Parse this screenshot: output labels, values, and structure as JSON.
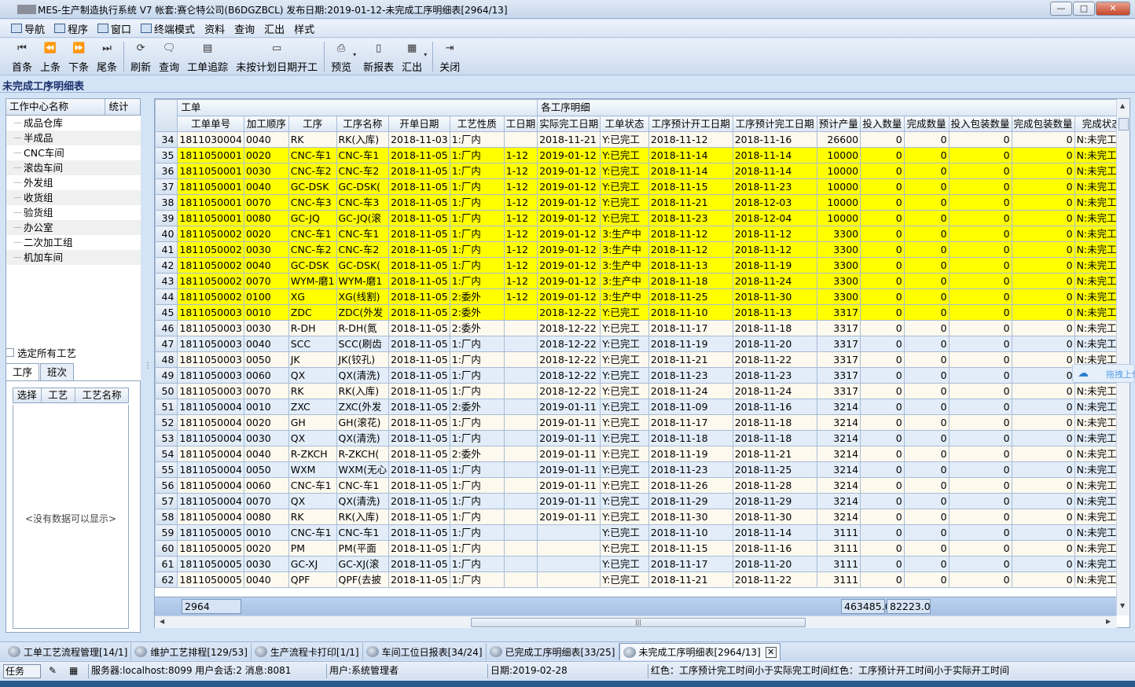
{
  "window": {
    "title": "MES-生产制造执行系统 V7 帐套:赛仑特公司(B6DGZBCL) 发布日期:2019-01-12-未完成工序明细表[2964/13]",
    "btn_min": "—",
    "btn_max": "□",
    "btn_close": "✕"
  },
  "menu": [
    {
      "label": "导航",
      "icon": "navigation-icon"
    },
    {
      "label": "程序",
      "icon": "program-icon"
    },
    {
      "label": "窗口",
      "icon": "window-icon"
    },
    {
      "label": "终端模式",
      "icon": "terminal-icon"
    },
    {
      "label": "资料"
    },
    {
      "label": "查询"
    },
    {
      "label": "汇出"
    },
    {
      "label": "样式"
    }
  ],
  "toolbar": {
    "first": "首条",
    "first_icon": "⏮",
    "prev": "上条",
    "prev_icon": "⏪",
    "next": "下条",
    "next_icon": "⏩",
    "last": "尾条",
    "last_icon": "⏭",
    "refresh": "刷新",
    "refresh_icon": "⟳",
    "query": "查询",
    "query_icon": "🗨",
    "trace": "工单追踪",
    "trace_icon": "▤",
    "unplanned": "未按计划日期开工",
    "unplanned_icon": "▭",
    "preview": "预览",
    "preview_icon": "⎙",
    "newreport": "新报表",
    "newreport_icon": "▯",
    "export": "汇出",
    "export_icon": "▦",
    "close": "关闭",
    "close_icon": "⇥",
    "dropdown": "▾"
  },
  "page_title": "未完成工序明细表",
  "left": {
    "col_name": "工作中心名称",
    "col_stat": "统计",
    "work_centers": [
      "成品仓库",
      "半成品",
      "CNC车间",
      "滚齿车间",
      "外发组",
      "收货组",
      "验货组",
      "办公室",
      "二次加工组",
      "机加车间"
    ],
    "select_all": "选定所有工艺",
    "tab_proc": "工序",
    "tab_shift": "班次",
    "proc_cols": [
      "选择",
      "工艺",
      "工艺名称"
    ],
    "empty": "<没有数据可以显示>"
  },
  "grid": {
    "band_wo": "工单",
    "band_detail": "各工序明细",
    "columns": [
      "工单单号",
      "加工顺序",
      "工序",
      "工序名称",
      "开单日期",
      "工艺性质",
      "工日期",
      "实际完工日期",
      "工单状态",
      "工序预计开工日期",
      "工序预计完工日期",
      "预计产量",
      "投入数量",
      "完成数量",
      "投入包装数量",
      "完成包装数量",
      "完成状态"
    ],
    "rows": [
      [
        "34",
        "1811030004",
        "0040",
        "RK",
        "RK(入库)",
        "2018-11-03",
        "1:厂内",
        "",
        "2018-11-21",
        "Y:已完工",
        "2018-11-12",
        "2018-11-16",
        "26600",
        "0",
        "0",
        "0",
        "0",
        "N:未完工"
      ],
      [
        "35",
        "1811050001",
        "0020",
        "CNC-车1",
        "CNC-车1",
        "2018-11-05",
        "1:厂内",
        "1-12",
        "2019-01-12",
        "Y:已完工",
        "2018-11-14",
        "2018-11-14",
        "10000",
        "0",
        "0",
        "0",
        "0",
        "N:未完工"
      ],
      [
        "36",
        "1811050001",
        "0030",
        "CNC-车2",
        "CNC-车2",
        "2018-11-05",
        "1:厂内",
        "1-12",
        "2019-01-12",
        "Y:已完工",
        "2018-11-14",
        "2018-11-14",
        "10000",
        "0",
        "0",
        "0",
        "0",
        "N:未完工"
      ],
      [
        "37",
        "1811050001",
        "0040",
        "GC-DSK",
        "GC-DSK(",
        "2018-11-05",
        "1:厂内",
        "1-12",
        "2019-01-12",
        "Y:已完工",
        "2018-11-15",
        "2018-11-23",
        "10000",
        "0",
        "0",
        "0",
        "0",
        "N:未完工"
      ],
      [
        "38",
        "1811050001",
        "0070",
        "CNC-车3",
        "CNC-车3",
        "2018-11-05",
        "1:厂内",
        "1-12",
        "2019-01-12",
        "Y:已完工",
        "2018-11-21",
        "2018-12-03",
        "10000",
        "0",
        "0",
        "0",
        "0",
        "N:未完工"
      ],
      [
        "39",
        "1811050001",
        "0080",
        "GC-JQ",
        "GC-JQ(滚",
        "2018-11-05",
        "1:厂内",
        "1-12",
        "2019-01-12",
        "Y:已完工",
        "2018-11-23",
        "2018-12-04",
        "10000",
        "0",
        "0",
        "0",
        "0",
        "N:未完工"
      ],
      [
        "40",
        "1811050002",
        "0020",
        "CNC-车1",
        "CNC-车1",
        "2018-11-05",
        "1:厂内",
        "1-12",
        "2019-01-12",
        "3:生产中",
        "2018-11-12",
        "2018-11-12",
        "3300",
        "0",
        "0",
        "0",
        "0",
        "N:未完工"
      ],
      [
        "41",
        "1811050002",
        "0030",
        "CNC-车2",
        "CNC-车2",
        "2018-11-05",
        "1:厂内",
        "1-12",
        "2019-01-12",
        "3:生产中",
        "2018-11-12",
        "2018-11-12",
        "3300",
        "0",
        "0",
        "0",
        "0",
        "N:未完工"
      ],
      [
        "42",
        "1811050002",
        "0040",
        "GC-DSK",
        "GC-DSK(",
        "2018-11-05",
        "1:厂内",
        "1-12",
        "2019-01-12",
        "3:生产中",
        "2018-11-13",
        "2018-11-19",
        "3300",
        "0",
        "0",
        "0",
        "0",
        "N:未完工"
      ],
      [
        "43",
        "1811050002",
        "0070",
        "WYM-磨1",
        "WYM-磨1",
        "2018-11-05",
        "1:厂内",
        "1-12",
        "2019-01-12",
        "3:生产中",
        "2018-11-18",
        "2018-11-24",
        "3300",
        "0",
        "0",
        "0",
        "0",
        "N:未完工"
      ],
      [
        "44",
        "1811050002",
        "0100",
        "XG",
        "XG(线割)",
        "2018-11-05",
        "2:委外",
        "1-12",
        "2019-01-12",
        "3:生产中",
        "2018-11-25",
        "2018-11-30",
        "3300",
        "0",
        "0",
        "0",
        "0",
        "N:未完工"
      ],
      [
        "45",
        "1811050003",
        "0010",
        "ZDC",
        "ZDC(外发",
        "2018-11-05",
        "2:委外",
        "",
        "2018-12-22",
        "Y:已完工",
        "2018-11-10",
        "2018-11-13",
        "3317",
        "0",
        "0",
        "0",
        "0",
        "N:未完工"
      ],
      [
        "46",
        "1811050003",
        "0030",
        "R-DH",
        "R-DH(氮",
        "2018-11-05",
        "2:委外",
        "",
        "2018-12-22",
        "Y:已完工",
        "2018-11-17",
        "2018-11-18",
        "3317",
        "0",
        "0",
        "0",
        "0",
        "N:未完工"
      ],
      [
        "47",
        "1811050003",
        "0040",
        "SCC",
        "SCC(刷齿",
        "2018-11-05",
        "1:厂内",
        "",
        "2018-12-22",
        "Y:已完工",
        "2018-11-19",
        "2018-11-20",
        "3317",
        "0",
        "0",
        "0",
        "0",
        "N:未完工"
      ],
      [
        "48",
        "1811050003",
        "0050",
        "JK",
        "JK(铰孔)",
        "2018-11-05",
        "1:厂内",
        "",
        "2018-12-22",
        "Y:已完工",
        "2018-11-21",
        "2018-11-22",
        "3317",
        "0",
        "0",
        "0",
        "0",
        "N:未完工"
      ],
      [
        "49",
        "1811050003",
        "0060",
        "QX",
        "QX(清洗)",
        "2018-11-05",
        "1:厂内",
        "",
        "2018-12-22",
        "Y:已完工",
        "2018-11-23",
        "2018-11-23",
        "3317",
        "0",
        "0",
        "0",
        "0",
        "N:未完工"
      ],
      [
        "50",
        "1811050003",
        "0070",
        "RK",
        "RK(入库)",
        "2018-11-05",
        "1:厂内",
        "",
        "2018-12-22",
        "Y:已完工",
        "2018-11-24",
        "2018-11-24",
        "3317",
        "0",
        "0",
        "0",
        "0",
        "N:未完工"
      ],
      [
        "51",
        "1811050004",
        "0010",
        "ZXC",
        "ZXC(外发",
        "2018-11-05",
        "2:委外",
        "",
        "2019-01-11",
        "Y:已完工",
        "2018-11-09",
        "2018-11-16",
        "3214",
        "0",
        "0",
        "0",
        "0",
        "N:未完工"
      ],
      [
        "52",
        "1811050004",
        "0020",
        "GH",
        "GH(滚花)",
        "2018-11-05",
        "1:厂内",
        "",
        "2019-01-11",
        "Y:已完工",
        "2018-11-17",
        "2018-11-18",
        "3214",
        "0",
        "0",
        "0",
        "0",
        "N:未完工"
      ],
      [
        "53",
        "1811050004",
        "0030",
        "QX",
        "QX(清洗)",
        "2018-11-05",
        "1:厂内",
        "",
        "2019-01-11",
        "Y:已完工",
        "2018-11-18",
        "2018-11-18",
        "3214",
        "0",
        "0",
        "0",
        "0",
        "N:未完工"
      ],
      [
        "54",
        "1811050004",
        "0040",
        "R-ZKCH",
        "R-ZKCH(",
        "2018-11-05",
        "2:委外",
        "",
        "2019-01-11",
        "Y:已完工",
        "2018-11-19",
        "2018-11-21",
        "3214",
        "0",
        "0",
        "0",
        "0",
        "N:未完工"
      ],
      [
        "55",
        "1811050004",
        "0050",
        "WXM",
        "WXM(无心",
        "2018-11-05",
        "1:厂内",
        "",
        "2019-01-11",
        "Y:已完工",
        "2018-11-23",
        "2018-11-25",
        "3214",
        "0",
        "0",
        "0",
        "0",
        "N:未完工"
      ],
      [
        "56",
        "1811050004",
        "0060",
        "CNC-车1",
        "CNC-车1",
        "2018-11-05",
        "1:厂内",
        "",
        "2019-01-11",
        "Y:已完工",
        "2018-11-26",
        "2018-11-28",
        "3214",
        "0",
        "0",
        "0",
        "0",
        "N:未完工"
      ],
      [
        "57",
        "1811050004",
        "0070",
        "QX",
        "QX(清洗)",
        "2018-11-05",
        "1:厂内",
        "",
        "2019-01-11",
        "Y:已完工",
        "2018-11-29",
        "2018-11-29",
        "3214",
        "0",
        "0",
        "0",
        "0",
        "N:未完工"
      ],
      [
        "58",
        "1811050004",
        "0080",
        "RK",
        "RK(入库)",
        "2018-11-05",
        "1:厂内",
        "",
        "2019-01-11",
        "Y:已完工",
        "2018-11-30",
        "2018-11-30",
        "3214",
        "0",
        "0",
        "0",
        "0",
        "N:未完工"
      ],
      [
        "59",
        "1811050005",
        "0010",
        "CNC-车1",
        "CNC-车1",
        "2018-11-05",
        "1:厂内",
        "",
        "",
        "Y:已完工",
        "2018-11-10",
        "2018-11-14",
        "3111",
        "0",
        "0",
        "0",
        "0",
        "N:未完工"
      ],
      [
        "60",
        "1811050005",
        "0020",
        "PM",
        "PM(平面",
        "2018-11-05",
        "1:厂内",
        "",
        "",
        "Y:已完工",
        "2018-11-15",
        "2018-11-16",
        "3111",
        "0",
        "0",
        "0",
        "0",
        "N:未完工"
      ],
      [
        "61",
        "1811050005",
        "0030",
        "GC-XJ",
        "GC-XJ(滚",
        "2018-11-05",
        "1:厂内",
        "",
        "",
        "Y:已完工",
        "2018-11-17",
        "2018-11-20",
        "3111",
        "0",
        "0",
        "0",
        "0",
        "N:未完工"
      ],
      [
        "62",
        "1811050005",
        "0040",
        "QPF",
        "QPF(去披",
        "2018-11-05",
        "1:厂内",
        "",
        "",
        "Y:已完工",
        "2018-11-21",
        "2018-11-22",
        "3111",
        "0",
        "0",
        "0",
        "0",
        "N:未完工"
      ]
    ],
    "yellow_rows": [
      35,
      36,
      37,
      38,
      39,
      40,
      41,
      42,
      43,
      44,
      45
    ],
    "footer_count": "2964",
    "footer_input_total": "463485.0",
    "footer_done_total": "82223.0"
  },
  "float_widget": {
    "label": "拖拽上传",
    "icon": "cloud-upload-icon"
  },
  "bottom_tabs": [
    {
      "label": "工单工艺流程管理[14/1]",
      "active": false
    },
    {
      "label": "维护工艺排程[129/53]",
      "active": false
    },
    {
      "label": "生产流程卡打印[1/1]",
      "active": false
    },
    {
      "label": "车间工位日报表[34/24]",
      "active": false
    },
    {
      "label": "已完成工序明细表[33/25]",
      "active": false
    },
    {
      "label": "未完成工序明细表[2964/13]",
      "active": true
    }
  ],
  "status": {
    "task": "任务",
    "server": "服务器:localhost:8099 用户会话:2 消息:8081",
    "user": "用户:系统管理者",
    "date": "日期:2019-02-28",
    "note": "红色：工序预计完工时间小于实际完工时间红色：工序预计开工时间小于实际开工时间"
  }
}
